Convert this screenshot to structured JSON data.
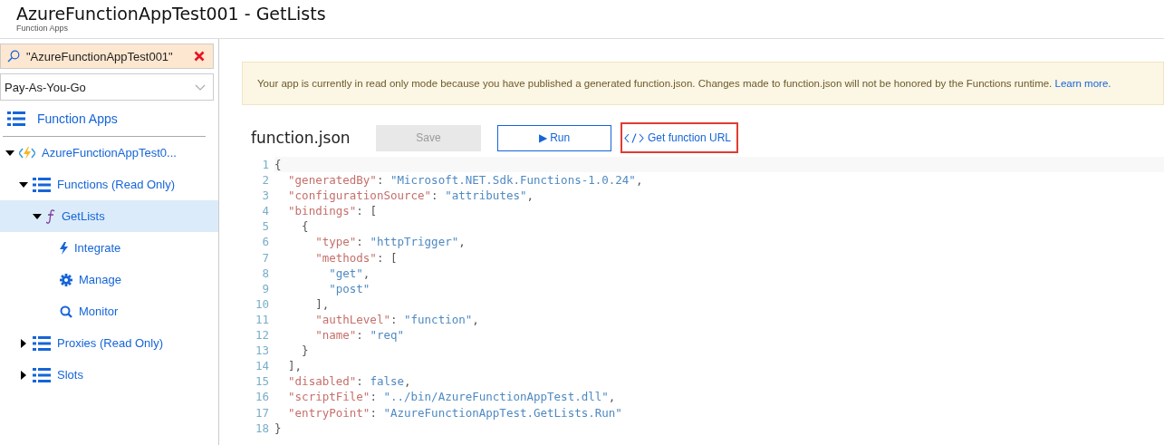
{
  "header": {
    "title": "AzureFunctionAppTest001 - GetLists",
    "subtitle": "Function Apps"
  },
  "sidebar": {
    "search": {
      "value": "\"AzureFunctionAppTest001\""
    },
    "subscription": {
      "value": "Pay-As-You-Go"
    },
    "top_item": {
      "label": "Function Apps",
      "kind": "list"
    },
    "tree": [
      {
        "label": "AzureFunctionAppTest0...",
        "kind": "app",
        "expanded": true,
        "selected": false,
        "children": [
          {
            "label": "Functions (Read Only)",
            "kind": "list",
            "expanded": true,
            "selected": false,
            "children": [
              {
                "label": "GetLists",
                "kind": "function",
                "expanded": true,
                "selected": true,
                "children": [
                  {
                    "label": "Integrate",
                    "kind": "bolt",
                    "selected": false
                  },
                  {
                    "label": "Manage",
                    "kind": "gear",
                    "selected": false
                  },
                  {
                    "label": "Monitor",
                    "kind": "search",
                    "selected": false
                  }
                ]
              }
            ]
          },
          {
            "label": "Proxies (Read Only)",
            "kind": "list",
            "expanded": false,
            "selected": false
          },
          {
            "label": "Slots",
            "kind": "list",
            "expanded": false,
            "selected": false
          }
        ]
      }
    ]
  },
  "notice": {
    "text": "Your app is currently in read only mode because you have published a generated function.json. Changes made to function.json will not be honored by the Functions runtime.",
    "link": "Learn more."
  },
  "editor": {
    "file_name": "function.json",
    "save_button": {
      "label": "Save",
      "disabled": true
    },
    "run_button": {
      "label": "Run",
      "icon": "▶"
    },
    "url_link": {
      "label": "Get function URL",
      "highlighted": true
    },
    "lines": [
      {
        "number": "1",
        "text": "{"
      },
      {
        "number": "2",
        "text": "  \"generatedBy\": \"Microsoft.NET.Sdk.Functions-1.0.24\","
      },
      {
        "number": "3",
        "text": "  \"configurationSource\": \"attributes\","
      },
      {
        "number": "4",
        "text": "  \"bindings\": ["
      },
      {
        "number": "5",
        "text": "    {"
      },
      {
        "number": "6",
        "text": "      \"type\": \"httpTrigger\","
      },
      {
        "number": "7",
        "text": "      \"methods\": ["
      },
      {
        "number": "8",
        "text": "        \"get\","
      },
      {
        "number": "9",
        "text": "        \"post\""
      },
      {
        "number": "10",
        "text": "      ],"
      },
      {
        "number": "11",
        "text": "      \"authLevel\": \"function\","
      },
      {
        "number": "12",
        "text": "      \"name\": \"req\""
      },
      {
        "number": "13",
        "text": "    }"
      },
      {
        "number": "14",
        "text": "  ],"
      },
      {
        "number": "15",
        "text": "  \"disabled\": false,"
      },
      {
        "number": "16",
        "text": "  \"scriptFile\": \"../bin/AzureFunctionAppTest.dll\","
      },
      {
        "number": "17",
        "text": "  \"entryPoint\": \"AzureFunctionAppTest.GetLists.Run\""
      },
      {
        "number": "18",
        "text": "}"
      }
    ]
  }
}
